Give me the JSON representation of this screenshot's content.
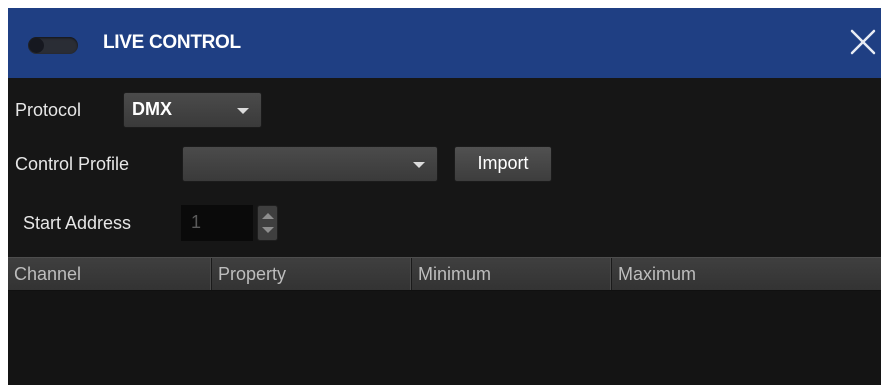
{
  "window": {
    "title": "LIVE CONTROL",
    "enabled": false
  },
  "protocol": {
    "label": "Protocol",
    "selected": "DMX"
  },
  "control_profile": {
    "label": "Control Profile",
    "selected": "",
    "import_label": "Import"
  },
  "start_address": {
    "label": "Start Address",
    "value": "1"
  },
  "table": {
    "columns": [
      "Channel",
      "Property",
      "Minimum",
      "Maximum"
    ],
    "rows": []
  },
  "colors": {
    "titlebar": "#1f3f83",
    "background": "#161616",
    "title_text": "#ffffff"
  },
  "icons": {
    "toggle": "toggle-switch-icon",
    "close": "close-icon",
    "dropdown": "caret-down-icon",
    "spinner": "spinner-arrows-icon"
  }
}
